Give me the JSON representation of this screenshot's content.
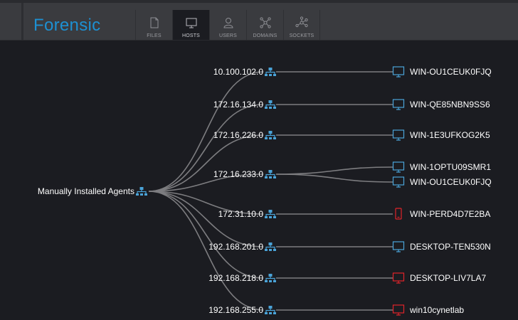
{
  "app": {
    "title": "Forensic"
  },
  "nav": {
    "tabs": [
      {
        "label": "FILES",
        "icon": "files-icon"
      },
      {
        "label": "HOSTS",
        "icon": "monitor-icon",
        "active": true
      },
      {
        "label": "USERS",
        "icon": "user-icon"
      },
      {
        "label": "DOMAINS",
        "icon": "domains-icon"
      },
      {
        "label": "SOCKETS",
        "icon": "sockets-icon"
      }
    ]
  },
  "tree": {
    "root": {
      "label": "Manually Installed Agents"
    },
    "subnets": [
      {
        "label": "10.100.102.0",
        "hosts": [
          {
            "name": "WIN-OU1CEUK0FJQ",
            "type": "desktop",
            "status": "normal"
          }
        ]
      },
      {
        "label": "172.16.134.0",
        "hosts": [
          {
            "name": "WIN-QE85NBN9SS6",
            "type": "desktop",
            "status": "normal"
          }
        ]
      },
      {
        "label": "172.16.226.0",
        "hosts": [
          {
            "name": "WIN-1E3UFKOG2K5",
            "type": "desktop",
            "status": "normal"
          }
        ]
      },
      {
        "label": "172.16.233.0",
        "hosts": [
          {
            "name": "WIN-1OPTU09SMR1",
            "type": "desktop",
            "status": "normal"
          },
          {
            "name": "WIN-OU1CEUK0FJQ",
            "type": "desktop",
            "status": "normal"
          }
        ]
      },
      {
        "label": "172.31.10.0",
        "hosts": [
          {
            "name": "WIN-PERD4D7E2BA",
            "type": "mobile",
            "status": "alert"
          }
        ]
      },
      {
        "label": "192.168.201.0",
        "hosts": [
          {
            "name": "DESKTOP-TEN530N",
            "type": "desktop",
            "status": "normal"
          }
        ]
      },
      {
        "label": "192.168.218.0",
        "hosts": [
          {
            "name": "DESKTOP-LIV7LA7",
            "type": "desktop",
            "status": "alert"
          }
        ]
      },
      {
        "label": "192.168.255.0",
        "hosts": [
          {
            "name": "win10cynetlab",
            "type": "desktop",
            "status": "alert"
          }
        ]
      }
    ]
  },
  "colors": {
    "brand": "#1d90d2",
    "network_icon": "#4aa3d8",
    "host_normal": "#4aa3d8",
    "host_alert": "#e0242a",
    "link": "#7d7d80"
  }
}
